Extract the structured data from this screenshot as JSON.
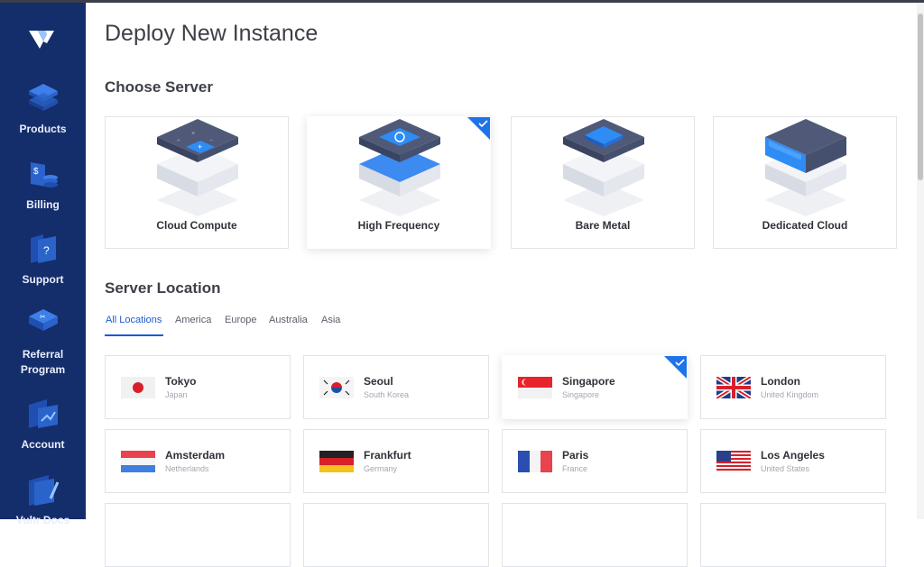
{
  "sidebar": {
    "items": [
      {
        "label_lines": [
          "Products"
        ],
        "icon": "products-icon"
      },
      {
        "label_lines": [
          "Billing"
        ],
        "icon": "billing-icon"
      },
      {
        "label_lines": [
          "Support"
        ],
        "icon": "support-icon"
      },
      {
        "label_lines": [
          "Referral",
          "Program"
        ],
        "icon": "referral-icon"
      },
      {
        "label_lines": [
          "Account"
        ],
        "icon": "account-icon"
      },
      {
        "label_lines": [
          "Vultr Docs"
        ],
        "icon": "docs-icon"
      }
    ]
  },
  "page": {
    "title": "Deploy New Instance"
  },
  "choose_server": {
    "title": "Choose Server",
    "options": [
      {
        "label": "Cloud Compute",
        "selected": false
      },
      {
        "label": "High Frequency",
        "selected": true
      },
      {
        "label": "Bare Metal",
        "selected": false
      },
      {
        "label": "Dedicated Cloud",
        "selected": false
      }
    ]
  },
  "server_location": {
    "title": "Server Location",
    "tabs": [
      "All Locations",
      "America",
      "Europe",
      "Australia",
      "Asia"
    ],
    "active_tab": "All Locations",
    "locations": [
      {
        "city": "Tokyo",
        "country": "Japan",
        "selected": false
      },
      {
        "city": "Seoul",
        "country": "South Korea",
        "selected": false
      },
      {
        "city": "Singapore",
        "country": "Singapore",
        "selected": true
      },
      {
        "city": "London",
        "country": "United Kingdom",
        "selected": false
      },
      {
        "city": "Amsterdam",
        "country": "Netherlands",
        "selected": false
      },
      {
        "city": "Frankfurt",
        "country": "Germany",
        "selected": false
      },
      {
        "city": "Paris",
        "country": "France",
        "selected": false
      },
      {
        "city": "Los Angeles",
        "country": "United States",
        "selected": false
      }
    ]
  },
  "colors": {
    "sidebar_bg": "#142d6b",
    "accent": "#1a5bd6",
    "selected_corner": "#1e73e8"
  }
}
